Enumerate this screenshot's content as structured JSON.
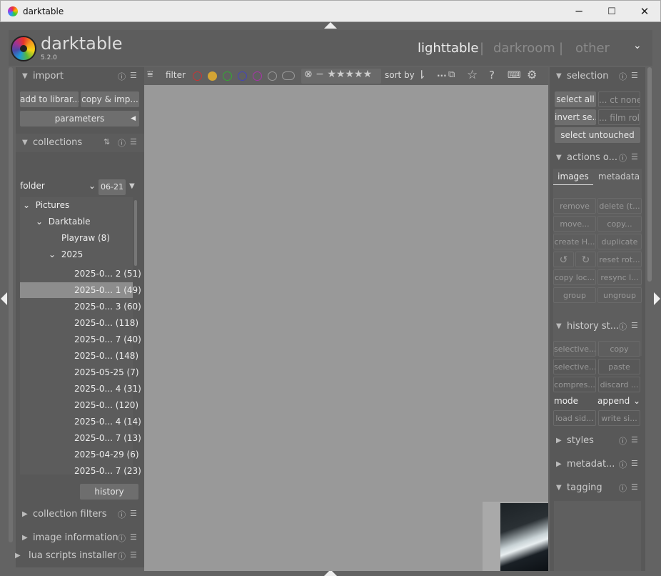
{
  "window": {
    "title": "darktable",
    "minimize": "─",
    "maximize": "☐",
    "close": "✕"
  },
  "header": {
    "logo": "darktable",
    "version": "5.2.0",
    "views": [
      "lighttable",
      "other"
    ],
    "active_view": "lighttable",
    "darkroom": "darkroom",
    "separator": "|"
  },
  "toolbar": {
    "filter_label": "filter",
    "sort_label": "sort by",
    "more": "..."
  },
  "left": {
    "import": {
      "title": "import",
      "add_library": "add to librar...",
      "copy_import": "copy & imp...",
      "parameters": "parameters"
    },
    "collections": {
      "title": "collections",
      "folder_select": "folder",
      "date_select": "06-21",
      "tree": [
        "Pictures",
        "Darktable",
        "Playraw (8)",
        "2025"
      ],
      "items": [
        "2025-0... 2 (51)",
        "2025-0... 1 (49)",
        "2025-0... 3 (60)",
        "2025-0... (118)",
        "2025-0... 7 (40)",
        "2025-0... (148)",
        "2025-05-25 (7)",
        "2025-0... 4 (31)",
        "2025-0... (120)",
        "2025-0... 4 (14)",
        "2025-0... 7 (13)",
        "2025-04-29 (6)",
        "2025-0... 7 (23)"
      ],
      "history": "history"
    },
    "collection_filters": "collection filters",
    "image_information": "image information",
    "lua": "lua scripts installer"
  },
  "right": {
    "selection": {
      "title": "selection",
      "select_all": "select all",
      "select_none": "... ct none",
      "invert": "invert se...",
      "film_roll": "... film roll",
      "untouched": "select untouched"
    },
    "actions": {
      "title": "actions o...",
      "tab_images": "images",
      "tab_metadata": "metadata",
      "buttons": [
        "remove",
        "delete (t...",
        "move...",
        "copy...",
        "create H...",
        "duplicate",
        "",
        "",
        "reset rot...",
        "copy loc...",
        "resync l...",
        "group",
        "ungroup"
      ]
    },
    "history": {
      "title": "history st...",
      "selective_copy": "selective...",
      "copy": "copy",
      "selective_paste": "selective...",
      "paste": "paste",
      "compress": "compres...",
      "discard": "discard ...",
      "mode_label": "mode",
      "mode_value": "append",
      "load": "load sid...",
      "write": "write si..."
    },
    "styles": "styles",
    "metadata": "metadat...",
    "tagging": "tagging"
  },
  "colors": {
    "bg": "#636363",
    "panel": "#585858",
    "center": "#999999",
    "selected": "#8d8d8d"
  }
}
